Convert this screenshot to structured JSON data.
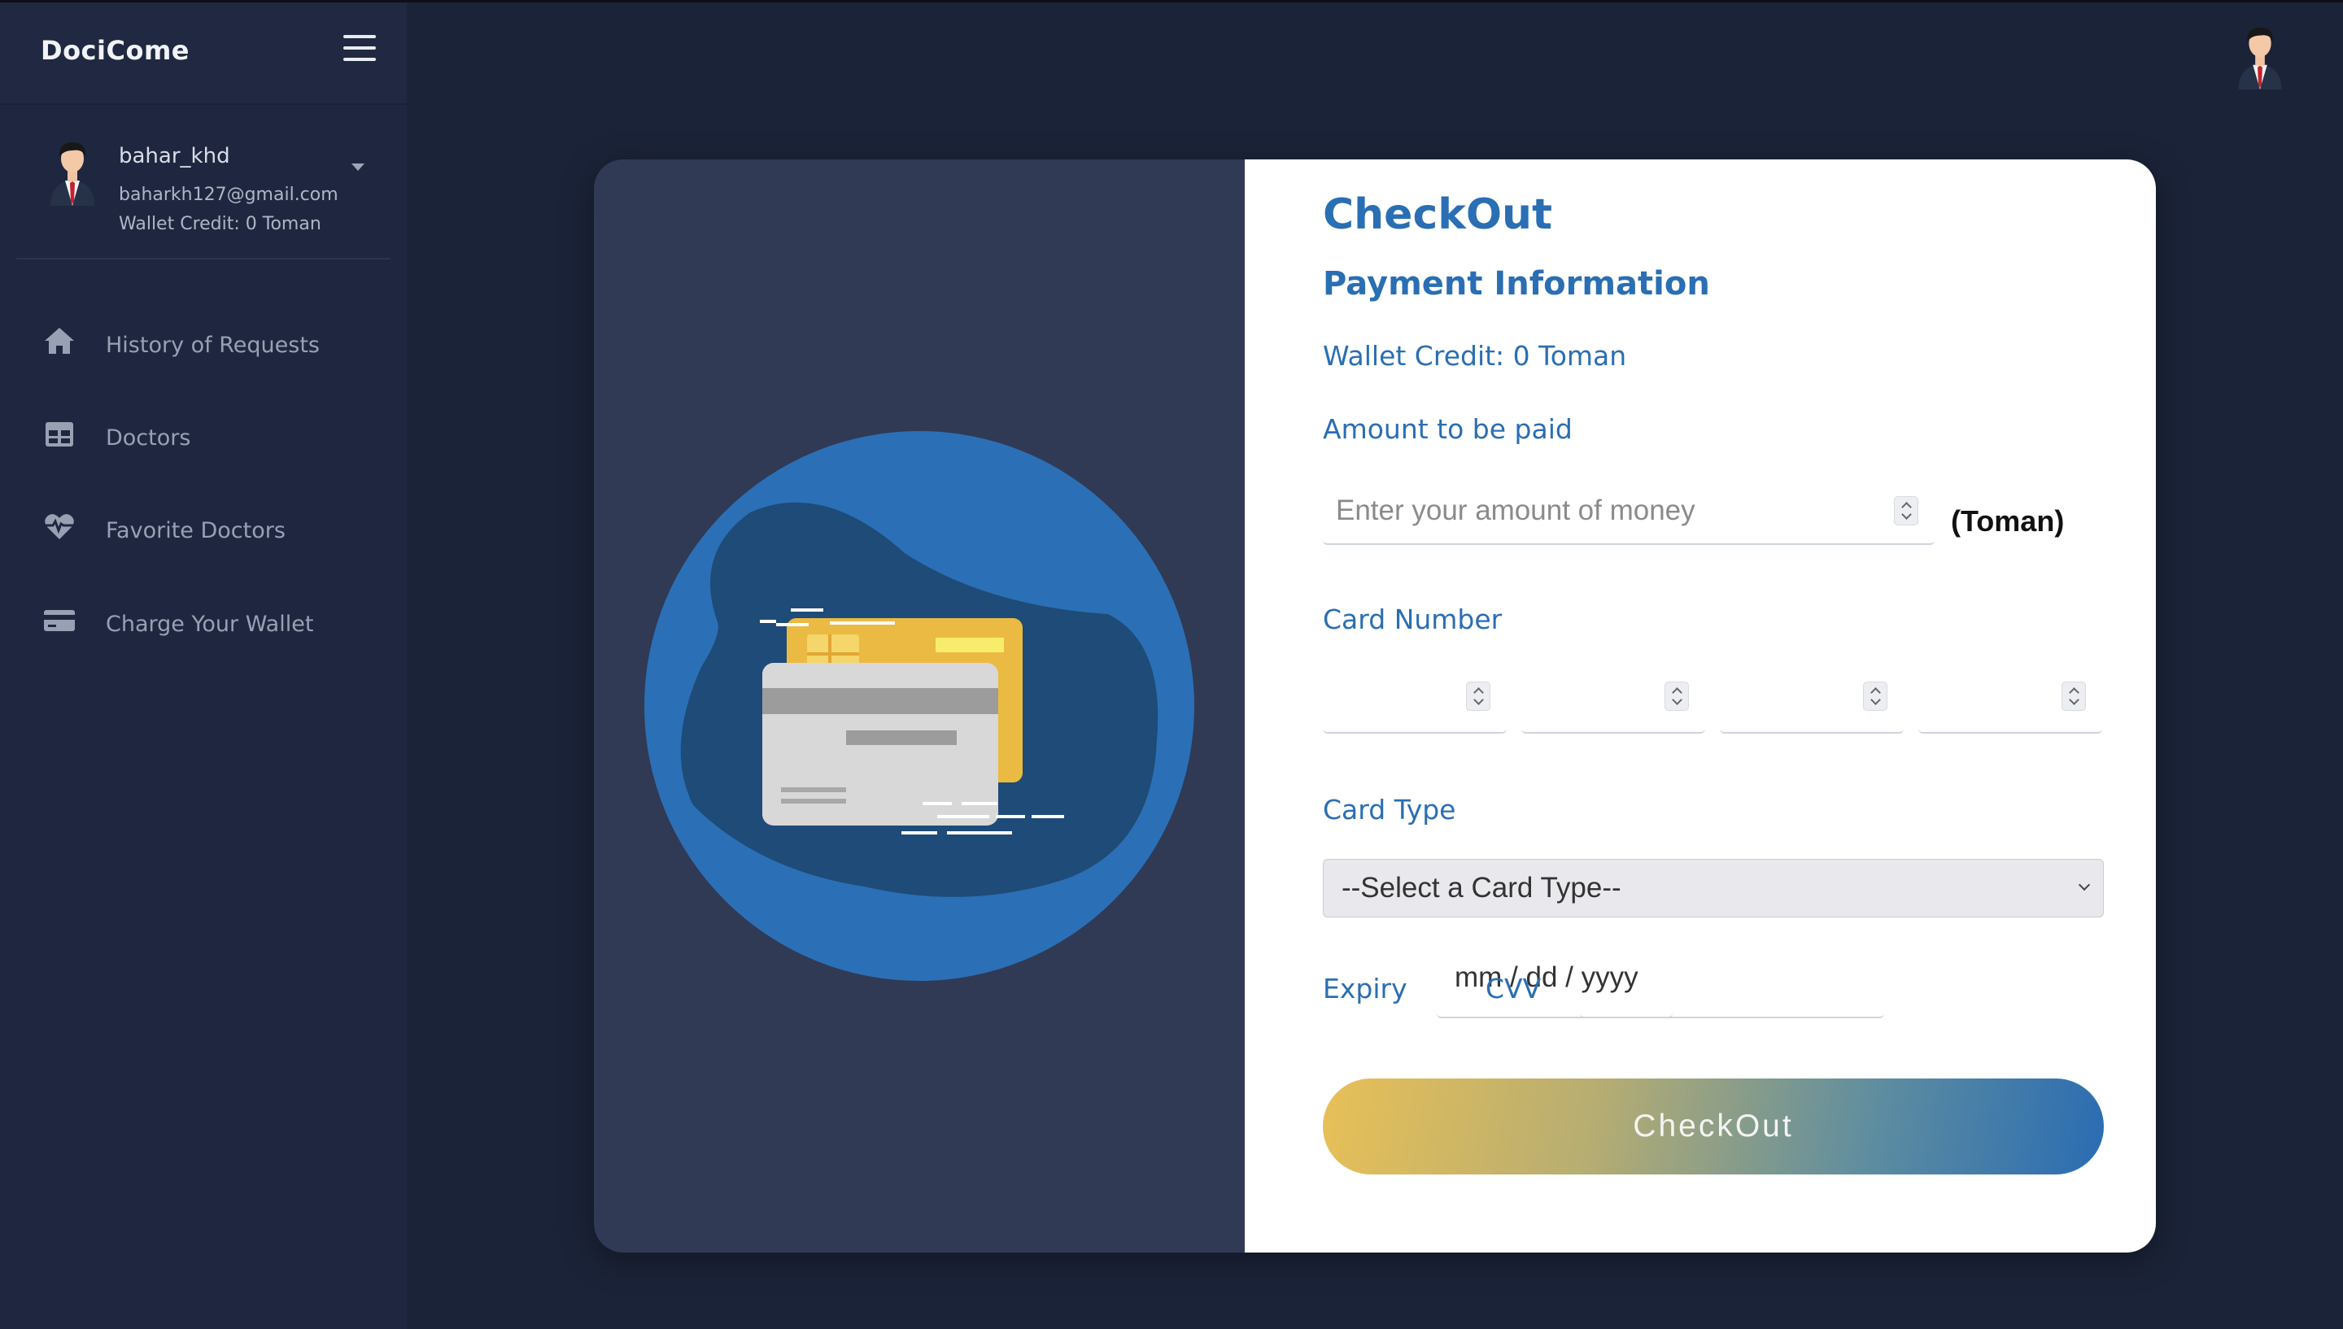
{
  "app": {
    "brand": "DociCome"
  },
  "user": {
    "username": "bahar_khd",
    "email": "baharkh127@gmail.com",
    "wallet": "Wallet Credit: 0 Toman"
  },
  "sidebar": {
    "items": [
      {
        "label": "History of Requests",
        "icon": "home-icon"
      },
      {
        "label": "Doctors",
        "icon": "table-icon"
      },
      {
        "label": "Favorite Doctors",
        "icon": "heart-pulse-icon"
      },
      {
        "label": "Charge Your Wallet",
        "icon": "credit-card-icon"
      }
    ]
  },
  "checkout": {
    "title": "CheckOut",
    "subtitle": "Payment Information",
    "wallet": "Wallet Credit: 0 Toman",
    "amount_label": "Amount to be paid",
    "amount_placeholder": "Enter your amount of money",
    "amount_value": "",
    "amount_unit": "(Toman)",
    "card_number_label": "Card Number",
    "card_type_label": "Card Type",
    "card_type_selected": "--Select a Card Type--",
    "expiry_label": "Expiry",
    "expiry_placeholder": "mm / dd / yyyy",
    "cvv_label": "CVV",
    "cvv_value": "",
    "button_label": "CheckOut"
  },
  "colors": {
    "accent": "#2a6eb3",
    "sidebar_bg": "#1f2740",
    "page_bg": "#1b2338",
    "gold": "#e8c057"
  }
}
